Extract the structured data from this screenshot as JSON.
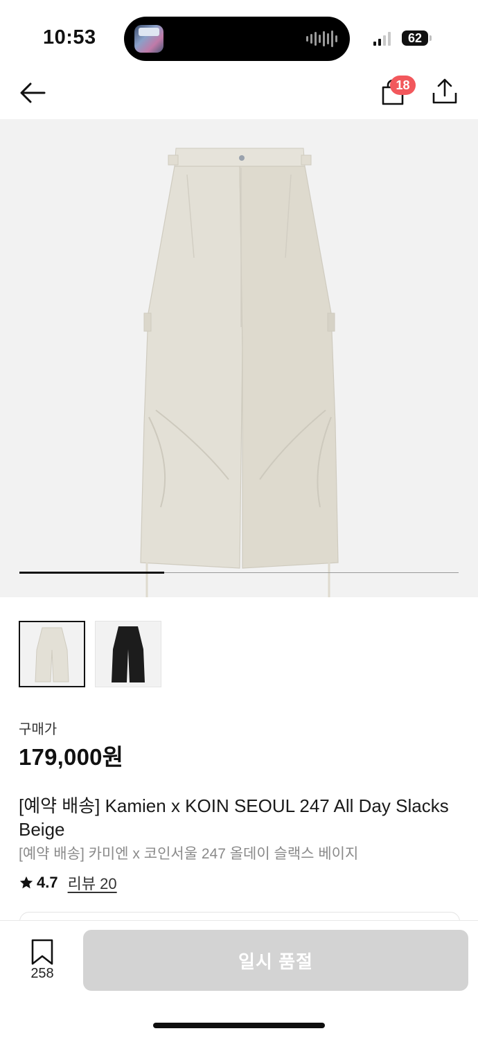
{
  "status_bar": {
    "time": "10:53",
    "battery": "62"
  },
  "header": {
    "cart_badge": "18"
  },
  "gallery": {
    "image_count": 2,
    "current_index": 1,
    "progress_fraction": 0.33
  },
  "thumbnails": [
    {
      "label": "beige-pants-thumbnail",
      "selected": true
    },
    {
      "label": "black-pants-thumbnail",
      "selected": false
    }
  ],
  "product": {
    "price_label": "구매가",
    "price": "179,000원",
    "title": "[예약 배송] Kamien x KOIN SEOUL 247 All Day Slacks Beige",
    "subtitle": "[예약 배송] 카미엔 x 코인서울 247 올데이 슬랙스 베이지",
    "rating": "4.7",
    "review_link": "리뷰 20"
  },
  "bottom_bar": {
    "bookmark_count": "258",
    "soldout_button": "일시 품절"
  },
  "colors": {
    "badge": "#f2585c",
    "button_disabled": "#d3d3d3",
    "hero_bg": "#f2f2f2",
    "pants_beige": "#e3e0d6",
    "pants_black": "#1c1c1c"
  }
}
